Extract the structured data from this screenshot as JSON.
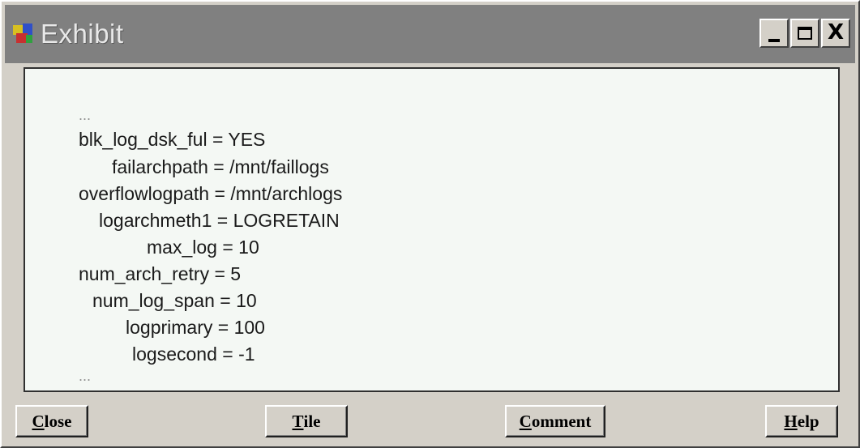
{
  "window": {
    "title": "Exhibit",
    "controls": {
      "minimize": "_",
      "maximize": "□",
      "close": "X"
    }
  },
  "content": {
    "lines": [
      "...",
      "blk_log_dsk_ful = YES",
      "failarchpath = /mnt/faillogs",
      "overflowlogpath = /mnt/archlogs",
      "logarchmeth1 = LOGRETAIN",
      "max_log = 10",
      "num_arch_retry = 5",
      "num_log_span = 10",
      "logprimary = 100",
      "logsecond = -1",
      "..."
    ]
  },
  "buttons": {
    "close": {
      "first": "C",
      "rest": "lose"
    },
    "tile": {
      "first": "T",
      "rest": "ile"
    },
    "comment": {
      "first": "C",
      "rest": "omment"
    },
    "help": {
      "first": "H",
      "rest": "elp"
    }
  }
}
